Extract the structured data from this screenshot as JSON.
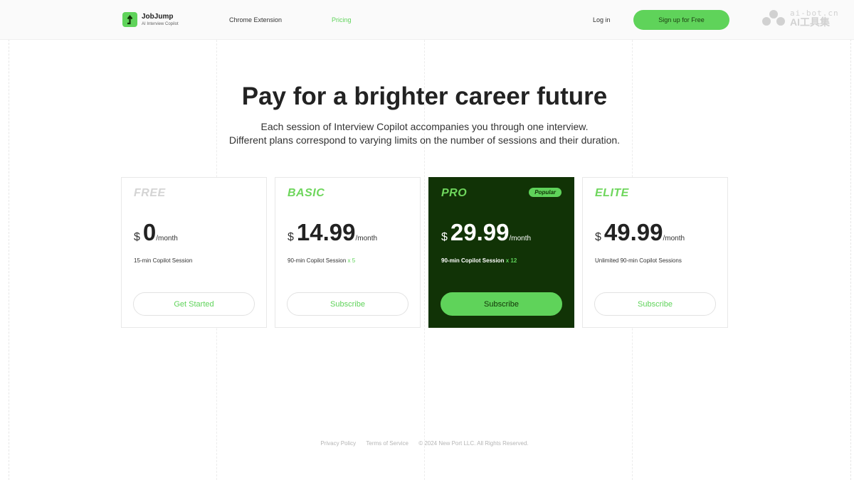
{
  "header": {
    "logo_name": "JobJump",
    "logo_tagline": "AI Interview Copilot",
    "nav": [
      {
        "label": "Chrome Extension",
        "active": false
      },
      {
        "label": "Pricing",
        "active": true
      }
    ],
    "login_label": "Log in",
    "signup_label": "Sign up for Free"
  },
  "watermark": {
    "line1": "ai-bot.cn",
    "line2": "AI工具集"
  },
  "hero": {
    "title": "Pay for a brighter career future",
    "subtitle_line1": "Each session of Interview Copilot accompanies you through one interview.",
    "subtitle_line2": "Different plans correspond to varying limits on the number of sessions and their duration."
  },
  "plans": [
    {
      "name": "FREE",
      "currency": "$",
      "amount": "0",
      "period": "/month",
      "feature": "15-min Copilot Session",
      "multiplier": "",
      "button": "Get Started",
      "badge": ""
    },
    {
      "name": "BASIC",
      "currency": "$",
      "amount": "14.99",
      "period": "/month",
      "feature": "90-min Copilot Session",
      "multiplier": "x 5",
      "button": "Subscribe",
      "badge": ""
    },
    {
      "name": "PRO",
      "currency": "$",
      "amount": "29.99",
      "period": "/month",
      "feature": "90-min Copilot Session",
      "multiplier": "x 12",
      "button": "Subscribe",
      "badge": "Popular"
    },
    {
      "name": "ELITE",
      "currency": "$",
      "amount": "49.99",
      "period": "/month",
      "feature": "Unlimited 90-min Copilot Sessions",
      "multiplier": "",
      "button": "Subscribe",
      "badge": ""
    }
  ],
  "footer": {
    "privacy": "Privacy Policy",
    "terms": "Terms of Service",
    "copyright": "© 2024 New Port LLC. All Rights Reserved."
  },
  "colors": {
    "accent": "#5fd35a",
    "pro_card_bg": "#113306"
  }
}
